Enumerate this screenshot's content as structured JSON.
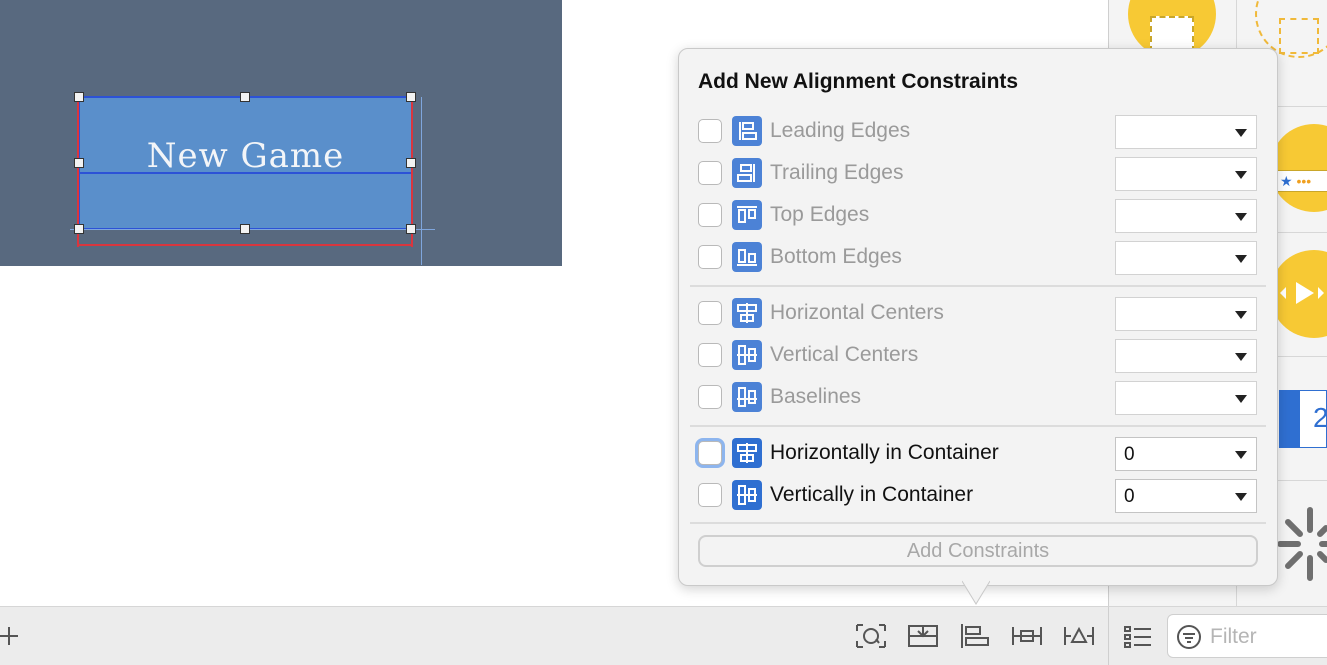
{
  "canvas": {
    "button_label": "New Game"
  },
  "popover": {
    "title": "Add New Alignment Constraints",
    "groups": [
      [
        {
          "label": "Leading Edges",
          "value": "",
          "enabled": false,
          "icon": "leading-edges-icon"
        },
        {
          "label": "Trailing Edges",
          "value": "",
          "enabled": false,
          "icon": "trailing-edges-icon"
        },
        {
          "label": "Top Edges",
          "value": "",
          "enabled": false,
          "icon": "top-edges-icon"
        },
        {
          "label": "Bottom Edges",
          "value": "",
          "enabled": false,
          "icon": "bottom-edges-icon"
        }
      ],
      [
        {
          "label": "Horizontal Centers",
          "value": "",
          "enabled": false,
          "icon": "horizontal-centers-icon"
        },
        {
          "label": "Vertical Centers",
          "value": "",
          "enabled": false,
          "icon": "vertical-centers-icon"
        },
        {
          "label": "Baselines",
          "value": "",
          "enabled": false,
          "icon": "baselines-icon"
        }
      ],
      [
        {
          "label": "Horizontally in Container",
          "value": "0",
          "enabled": true,
          "icon": "horizontally-in-container-icon"
        },
        {
          "label": "Vertically in Container",
          "value": "0",
          "enabled": true,
          "icon": "vertically-in-container-icon"
        }
      ]
    ],
    "add_button": "Add Constraints"
  },
  "library": {
    "filter_placeholder": "Filter",
    "partial_value": "2"
  },
  "bottom_toolbar": {
    "icons": [
      "add-icon",
      "update-frames-icon",
      "embed-in-stack-icon",
      "align-icon",
      "pin-icon",
      "resolve-issues-icon"
    ]
  },
  "colors": {
    "scene": "#58697f",
    "button_fill": "#5a8fcb",
    "selection": "#2c52d6",
    "constraint_red": "#d9363e",
    "icon_blue": "#2f6fd1",
    "library_yellow": "#f7c934"
  }
}
